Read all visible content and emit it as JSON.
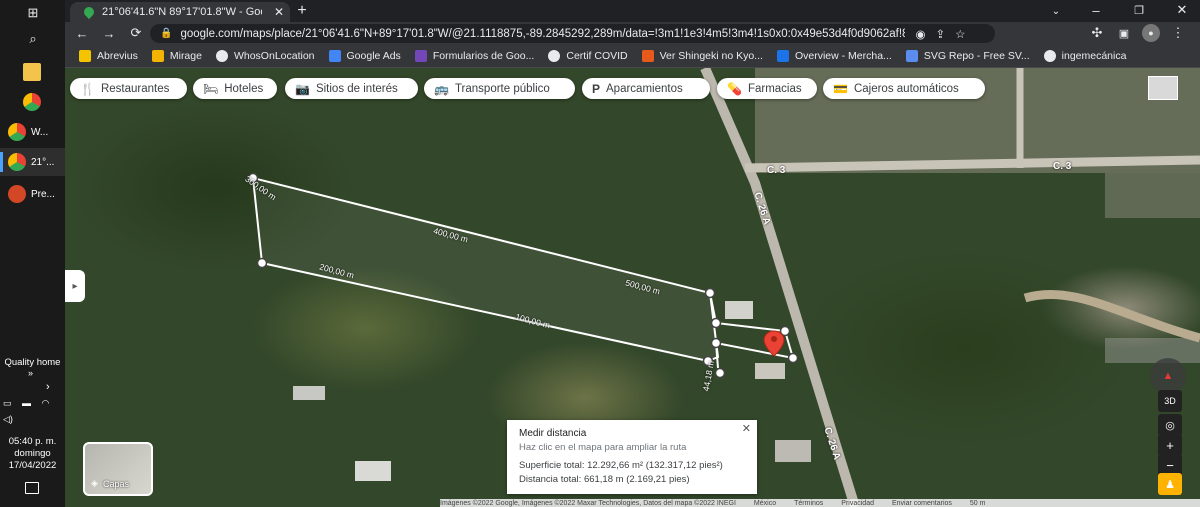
{
  "taskbar": {
    "items": [
      {
        "label": "W..."
      },
      {
        "label": "21°..."
      },
      {
        "label": "Pre..."
      }
    ],
    "quality_home": "Quality home",
    "time": "05:40 p. m.",
    "day": "domingo",
    "date": "17/04/2022"
  },
  "browser": {
    "tab_title": "21°06'41.6\"N 89°17'01.8\"W - Goo",
    "url": "google.com/maps/place/21°06'41.6\"N+89°17'01.8\"W/@21.1118875,-89.2845292,289m/data=!3m1!1e3!4m5!3m4!1s0x0:0x49e53d4f0d9062af!8m...",
    "bookmarks": [
      {
        "label": "Abrevius",
        "color": "#f5c400"
      },
      {
        "label": "Mirage",
        "color": "#f4b400"
      },
      {
        "label": "WhosOnLocation",
        "color": "#e8eaed"
      },
      {
        "label": "Google Ads",
        "color": "#4285f4"
      },
      {
        "label": "Formularios de Goo...",
        "color": "#7248b9"
      },
      {
        "label": "Certif COVID",
        "color": "#e8eaed"
      },
      {
        "label": "Ver Shingeki no Kyo...",
        "color": "#e85a1c"
      },
      {
        "label": "Overview - Mercha...",
        "color": "#1a73e8"
      },
      {
        "label": "SVG Repo - Free SV...",
        "color": "#5b8def"
      },
      {
        "label": "ingemecánica",
        "color": "#e8eaed"
      }
    ]
  },
  "map": {
    "chips": [
      {
        "icon": "🍴",
        "label": "Restaurantes"
      },
      {
        "icon": "🛏",
        "label": "Hoteles"
      },
      {
        "icon": "📷",
        "label": "Sitios de interés"
      },
      {
        "icon": "🚌",
        "label": "Transporte público"
      },
      {
        "icon": "P",
        "label": "Aparcamientos"
      },
      {
        "icon": "💊",
        "label": "Farmacias"
      },
      {
        "icon": "💳",
        "label": "Cajeros automáticos"
      }
    ],
    "road_labels": [
      "C. 3",
      "C. 3",
      "C. 26 A",
      "C. 26 A"
    ],
    "measurements": [
      "300,00 m",
      "400,00 m",
      "200,00 m",
      "500,00 m",
      "100,00 m",
      "44,18 m"
    ],
    "measure_card": {
      "title": "Medir distancia",
      "hint": "Haz clic en el mapa para ampliar la ruta",
      "area": "Superficie total: 12.292,66 m² (132.317,12 pies²)",
      "distance": "Distancia total: 661,18 m (2.169,21 pies)"
    },
    "layers_label": "Capas",
    "controls": {
      "3d": "3D",
      "zoom_in": "+",
      "zoom_out": "−"
    },
    "footer": [
      "Imágenes ©2022 Google, Imágenes ©2022 Maxar Technologies, Datos del mapa ©2022 INEGI",
      "México",
      "Términos",
      "Privacidad",
      "Enviar comentarios",
      "50 m"
    ]
  }
}
